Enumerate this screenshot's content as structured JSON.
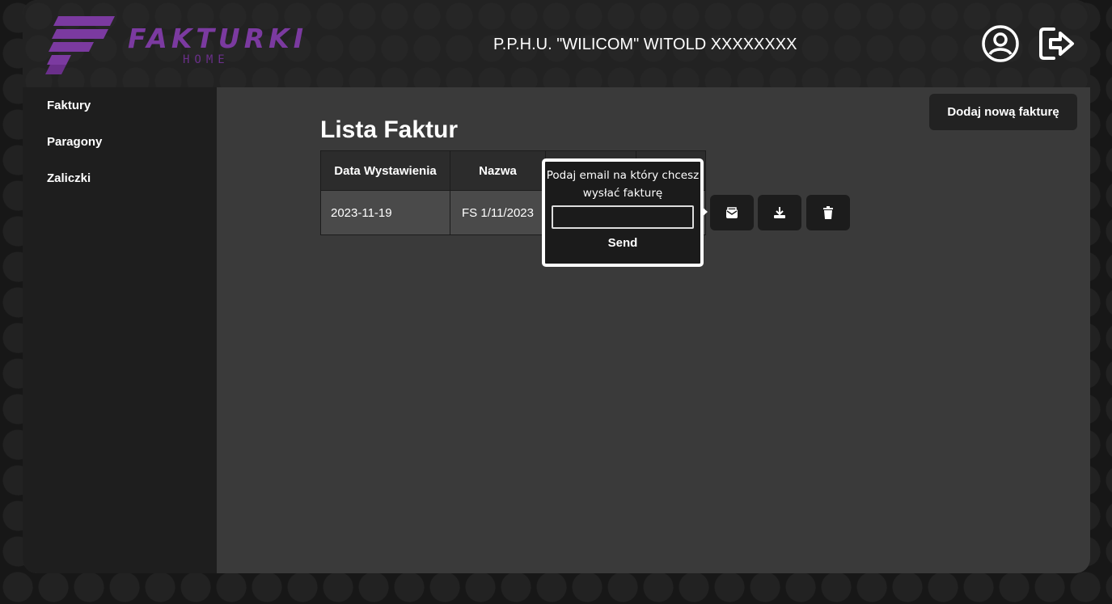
{
  "header": {
    "logo_title": "FAKTURKI",
    "logo_sub": "HOME",
    "company": "P.P.H.U. \"WILICOM\" WITOLD XXXXXXXX",
    "brand_color": "#7b3aa0"
  },
  "sidebar": {
    "items": [
      {
        "label": "Faktury"
      },
      {
        "label": "Paragony"
      },
      {
        "label": "Zaliczki"
      }
    ]
  },
  "main": {
    "add_button": "Dodaj nową fakturę",
    "title": "Lista Faktur",
    "table": {
      "headers": [
        "Data Wystawienia",
        "Nazwa",
        "",
        ""
      ],
      "rows": [
        {
          "date": "2023-11-19",
          "name": "FS 1/11/2023"
        }
      ]
    },
    "row_actions": [
      "mail-icon",
      "download-icon",
      "trash-icon"
    ]
  },
  "popover": {
    "prompt": "Podaj email na który chcesz wysłać fakturę",
    "email_value": "",
    "send_label": "Send"
  }
}
